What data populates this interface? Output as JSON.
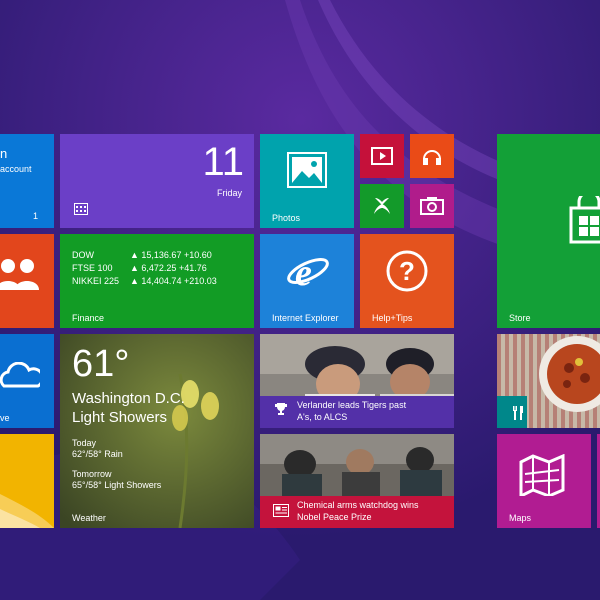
{
  "mail": {
    "line1": "n",
    "line2": "account",
    "badge": "1",
    "color": "#0a78d7"
  },
  "calendar": {
    "day_number": "11",
    "day_name": "Friday",
    "color": "#6b3fc7"
  },
  "photos": {
    "label": "Photos",
    "color": "#00a3ad"
  },
  "video": {
    "color": "#c5113a"
  },
  "music": {
    "color": "#ea4b17"
  },
  "games": {
    "color": "#139a2a"
  },
  "camera": {
    "color": "#b01c8b"
  },
  "store": {
    "label": "Store",
    "color": "#13a037"
  },
  "people": {
    "color": "#e2461c"
  },
  "finance": {
    "label": "Finance",
    "color": "#129c25",
    "rows": [
      {
        "name": "DOW",
        "value": "▲ 15,136.67 +10.60"
      },
      {
        "name": "FTSE 100",
        "value": "▲ 6,472.25 +41.76"
      },
      {
        "name": "NIKKEI 225",
        "value": "▲ 14,404.74 +210.03"
      }
    ]
  },
  "ie": {
    "label": "Internet Explorer",
    "color": "#1d82d9"
  },
  "help": {
    "label": "Help+Tips",
    "color": "#e4531e"
  },
  "sports_news": {
    "headline_line1": "Verlander leads Tigers past",
    "headline_line2": "A's, to ALCS",
    "color": "#5330a8"
  },
  "food": {
    "color": "#00878a"
  },
  "skydrive": {
    "label": "ve",
    "color": "#0a6fd1"
  },
  "weather": {
    "temp": "61°",
    "city": "Washington D.C.",
    "condition": "Light Showers",
    "today_label": "Today",
    "today_forecast": "62°/58° Rain",
    "tomorrow_label": "Tomorrow",
    "tomorrow_forecast": "65°/58° Light Showers",
    "label": "Weather"
  },
  "news": {
    "headline_line1": "Chemical arms watchdog wins",
    "headline_line2": "Nobel Peace Prize",
    "color": "#c4133c"
  },
  "maps": {
    "label": "Maps",
    "color": "#b11c92"
  },
  "desktop": {
    "color": "#f2b400"
  }
}
